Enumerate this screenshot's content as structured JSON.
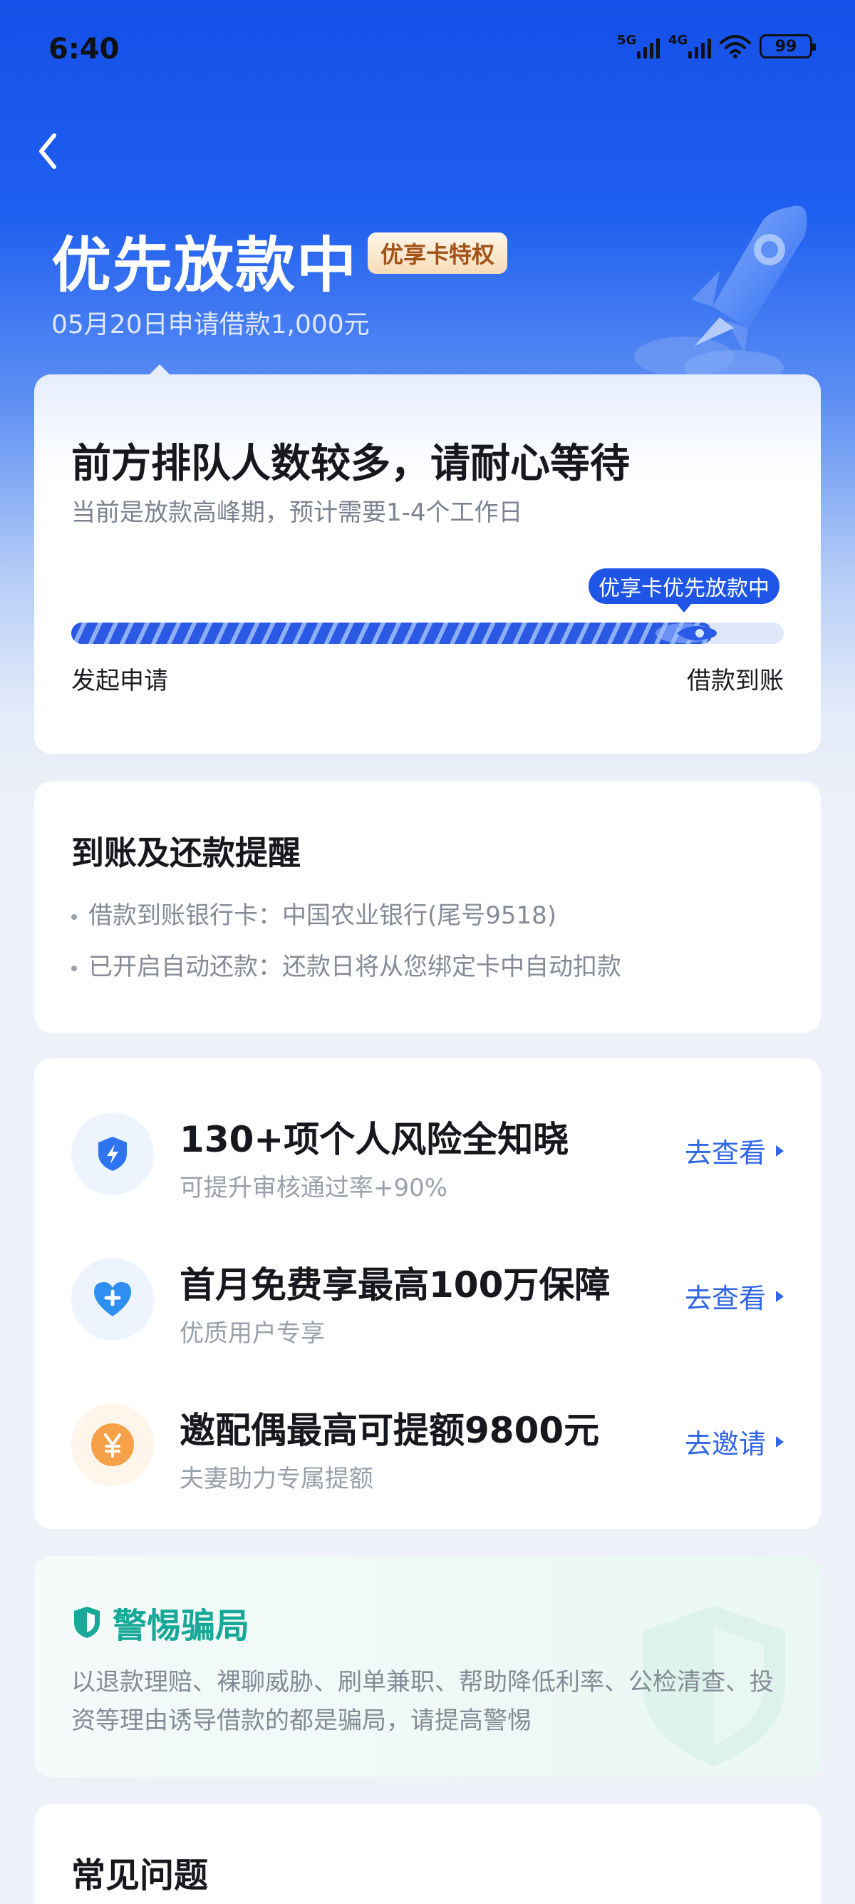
{
  "status_bar": {
    "time": "6:40",
    "signal_1_label": "5G",
    "signal_2_label": "4G",
    "battery": "99"
  },
  "header": {
    "title": "优先放款中",
    "badge": "优享卡特权",
    "subtitle": "05月20日申请借款1,000元"
  },
  "status_card": {
    "title": "前方排队人数较多，请耐心等待",
    "description": "当前是放款高峰期，预计需要1-4个工作日",
    "progress_tag": "优享卡优先放款中",
    "progress": 0.9,
    "start_label": "发起申请",
    "end_label": "借款到账"
  },
  "reminder": {
    "title": "到账及还款提醒",
    "lines": [
      "借款到账银行卡：中国农业银行(尾号9518)",
      "已开启自动还款：还款日将从您绑定卡中自动扣款"
    ]
  },
  "services": [
    {
      "title": "130+项个人风险全知晓",
      "subtitle": "可提升审核通过率+90%",
      "action": "去查看",
      "icon": "shield-bolt-icon"
    },
    {
      "title": "首月免费享最高100万保障",
      "subtitle": "优质用户专享",
      "action": "去查看",
      "icon": "heart-plus-icon"
    },
    {
      "title": "邀配偶最高可提额9800元",
      "subtitle": "夫妻助力专属提额",
      "action": "去邀请",
      "icon": "yen-coin-icon"
    }
  ],
  "warning": {
    "title": "警惕骗局",
    "text": "以退款理赔、裸聊威胁、刷单兼职、帮助降低利率、公检清查、投资等理由诱导借款的都是骗局，请提高警惕"
  },
  "faq": {
    "title": "常见问题"
  },
  "colors": {
    "primary": "#1f55e6",
    "accent_link": "#2f66e6",
    "warning_green": "#18a898",
    "badge_text": "#a2531a"
  }
}
